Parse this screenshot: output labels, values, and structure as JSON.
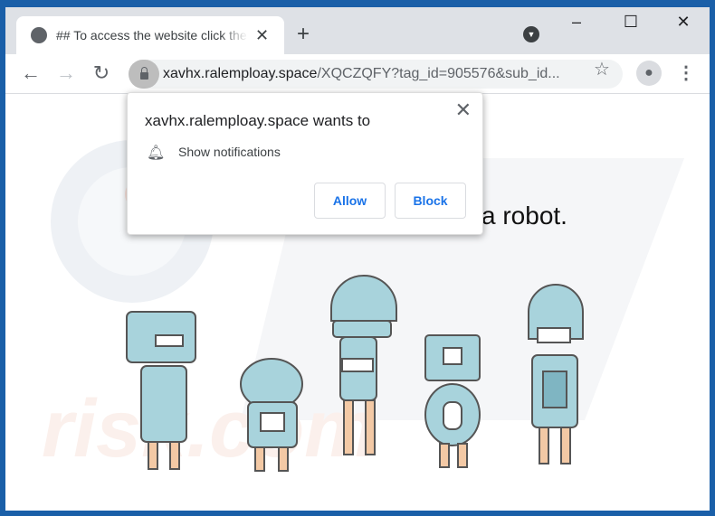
{
  "tab": {
    "title": "## To access the website click the",
    "icon": "globe-icon"
  },
  "window_controls": {
    "minimize": "–",
    "maximize": "☐",
    "close": "✕"
  },
  "address_bar": {
    "host": "xavhx.ralemploay.space",
    "path": "/XQCZQFY?tag_id=905576&sub_id..."
  },
  "page": {
    "message_visible": "a robot."
  },
  "permission_popup": {
    "title": "xavhx.ralemploay.space wants to",
    "permission": "Show notifications",
    "allow_label": "Allow",
    "block_label": "Block"
  },
  "colors": {
    "accent": "#1a73e8",
    "robot": "#a8d3dc",
    "outline": "#555555"
  }
}
